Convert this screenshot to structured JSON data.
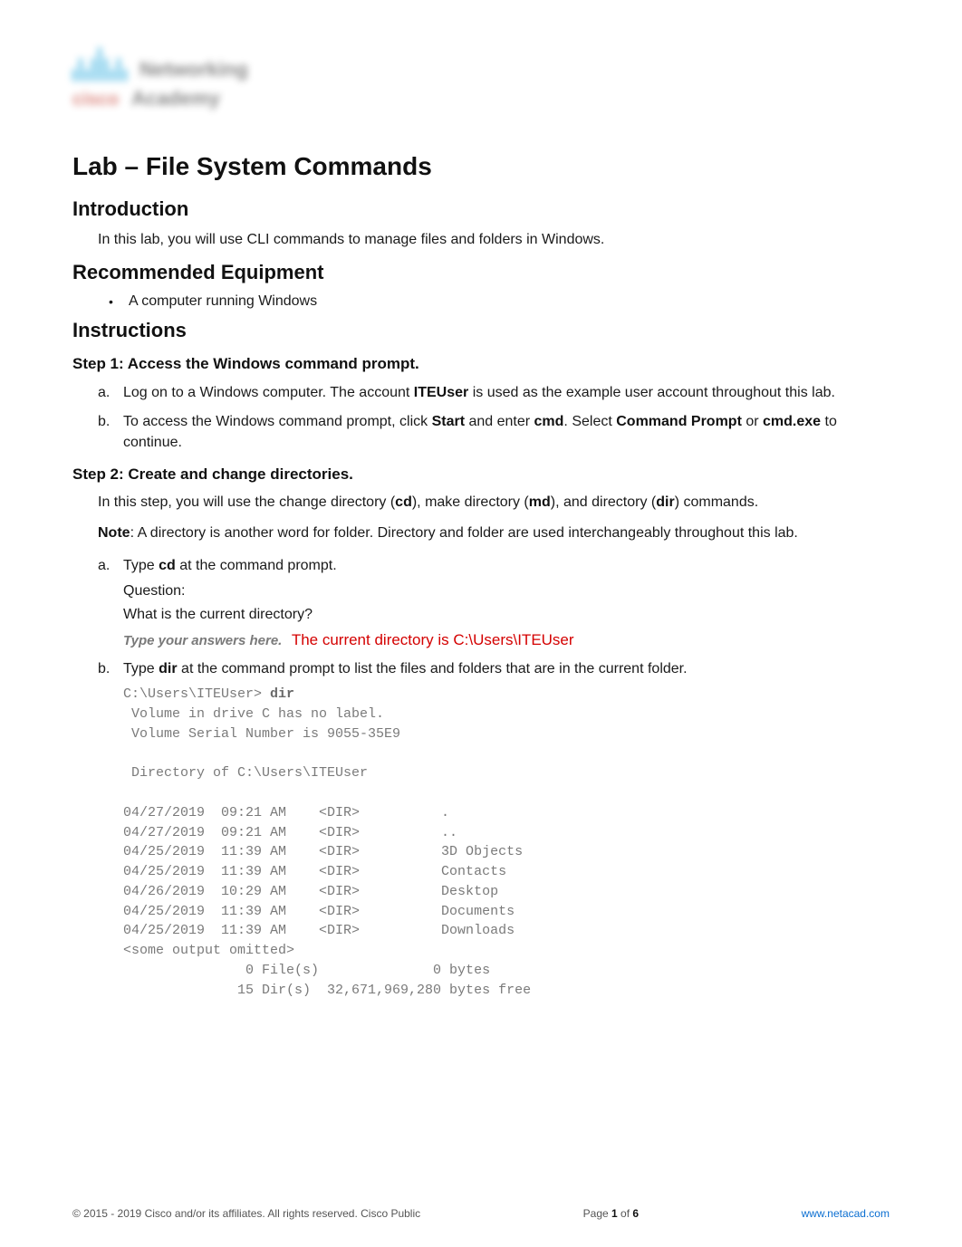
{
  "logo": {
    "line1": "Networking",
    "line2": "Academy",
    "brand": "cisco"
  },
  "title": "Lab – File System Commands",
  "sections": {
    "introduction": {
      "heading": "Introduction",
      "body": "In this lab, you will use CLI commands to manage files and folders in Windows."
    },
    "equipment": {
      "heading": "Recommended Equipment",
      "items": [
        "A computer running Windows"
      ]
    },
    "instructions": {
      "heading": "Instructions",
      "step1": {
        "heading": "Step 1: Access the Windows command prompt.",
        "a_pre": "Log on to a Windows computer. The account ",
        "a_bold1": "ITEUser",
        "a_post": " is used as the example user account throughout this lab.",
        "b_pre": "To access the Windows command prompt, click ",
        "b_bold1": "Start",
        "b_mid1": " and enter ",
        "b_bold2": "cmd",
        "b_mid2": ". Select ",
        "b_bold3": "Command Prompt",
        "b_mid3": " or ",
        "b_bold4": "cmd.exe",
        "b_post": " to continue."
      },
      "step2": {
        "heading": "Step 2: Create and change directories.",
        "intro_pre": "In this step, you will use the change directory (",
        "intro_b1": "cd",
        "intro_mid1": "), make directory (",
        "intro_b2": "md",
        "intro_mid2": "), and directory (",
        "intro_b3": "dir",
        "intro_post": ") commands.",
        "note_label": "Note",
        "note_body": ": A directory is another word for folder. Directory and folder are used interchangeably throughout this lab.",
        "a_pre": "Type ",
        "a_bold": "cd",
        "a_post": " at the command prompt.",
        "question_label": "Question:",
        "question_text": "What is the current directory?",
        "answer_prompt": "Type your answers here.",
        "answer_text": "The current directory is C:\\Users\\ITEUser",
        "b_pre": "Type ",
        "b_bold": "dir",
        "b_post": " at the command prompt to list the files and folders that are in the current folder.",
        "code": {
          "prompt": "C:\\Users\\ITEUser> ",
          "cmd": "dir",
          "lines": [
            " Volume in drive C has no label.",
            " Volume Serial Number is 9055-35E9",
            "",
            " Directory of C:\\Users\\ITEUser",
            "",
            "04/27/2019  09:21 AM    <DIR>          .",
            "04/27/2019  09:21 AM    <DIR>          ..",
            "04/25/2019  11:39 AM    <DIR>          3D Objects",
            "04/25/2019  11:39 AM    <DIR>          Contacts",
            "04/26/2019  10:29 AM    <DIR>          Desktop",
            "04/25/2019  11:39 AM    <DIR>          Documents",
            "04/25/2019  11:39 AM    <DIR>          Downloads",
            "<some output omitted>",
            "               0 File(s)              0 bytes",
            "              15 Dir(s)  32,671,969,280 bytes free"
          ]
        }
      }
    }
  },
  "footer": {
    "left": "© 2015 - 2019 Cisco and/or its affiliates. All rights reserved. Cisco Public",
    "center_pre": "Page ",
    "center_b1": "1",
    "center_mid": " of ",
    "center_b2": "6",
    "right": "www.netacad.com"
  }
}
